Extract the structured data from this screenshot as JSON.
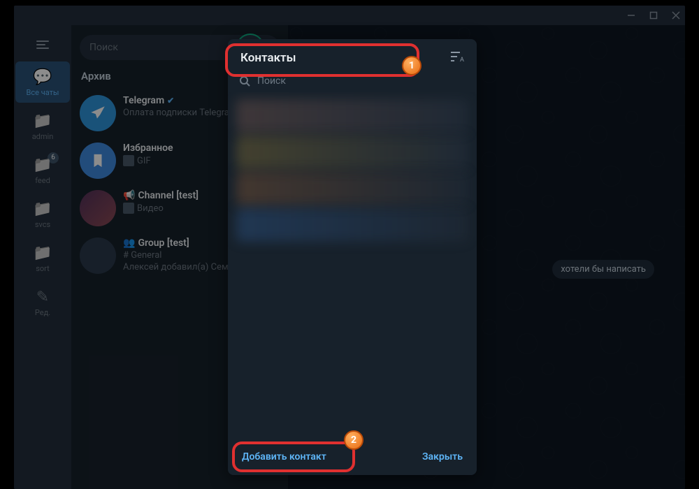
{
  "titlebar": {
    "minimize": "—",
    "maximize": "▢",
    "close": "✕"
  },
  "folders": {
    "all_chats": "Все чаты",
    "admin": "admin",
    "feed": "feed",
    "feed_badge": "6",
    "svcs": "svcs",
    "sort": "sort",
    "edit": "Ред."
  },
  "search": {
    "placeholder": "Поиск"
  },
  "archive_label": "Архив",
  "chats": {
    "telegram": {
      "title": "Telegram",
      "sub": "Оплата подписки Telegram"
    },
    "saved": {
      "title": "Избранное",
      "sub": "GIF"
    },
    "channel": {
      "title": "Channel [test]",
      "sub": "Видео"
    },
    "group": {
      "title": "Group [test]",
      "sub1": "# General",
      "sub2": "Алексей добавил(а) Семён"
    }
  },
  "modal": {
    "title": "Контакты",
    "search_placeholder": "Поиск",
    "add_contact": "Добавить контакт",
    "close": "Закрыть"
  },
  "placeholder_text": "хотели бы написать",
  "annotations": {
    "1": "1",
    "2": "2"
  }
}
